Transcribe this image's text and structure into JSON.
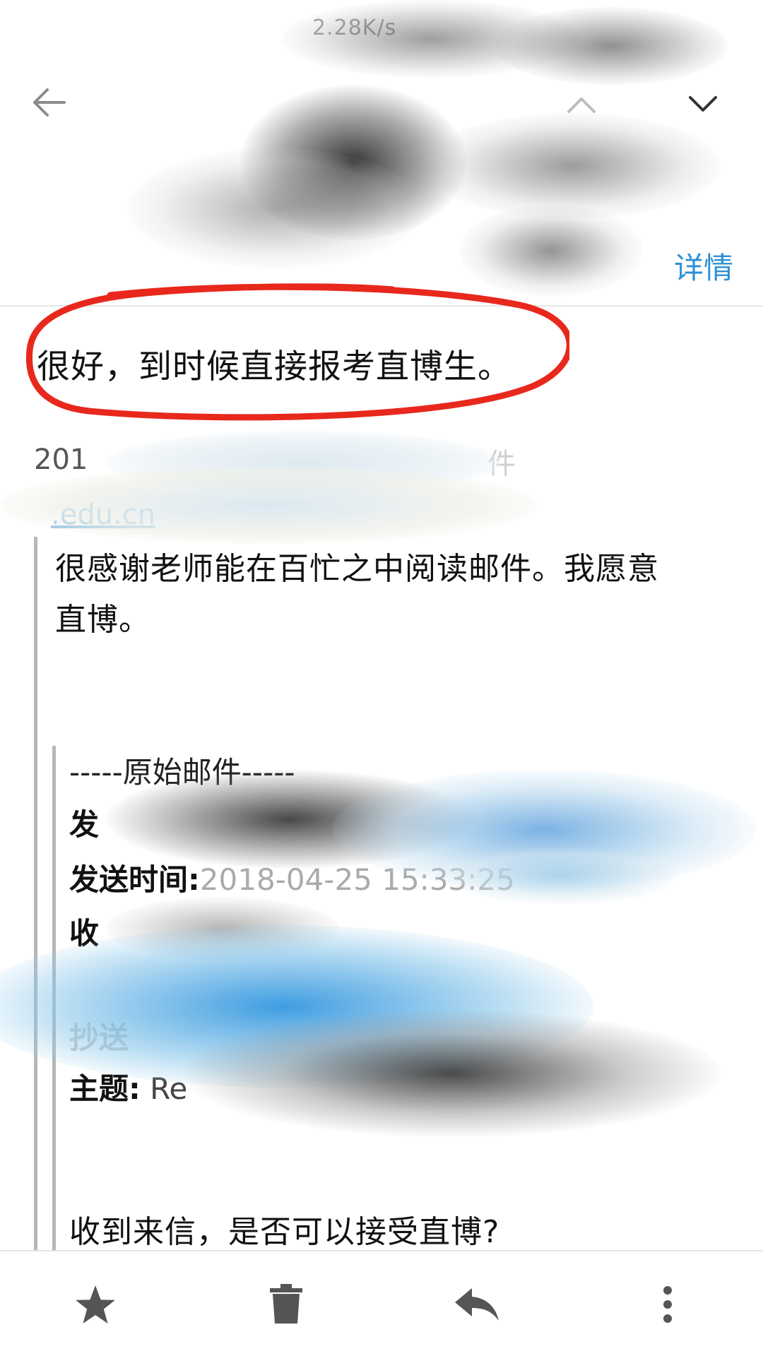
{
  "status": {
    "network_speed": "2.28K/s"
  },
  "toolbar": {
    "back_icon": "arrow-left-icon",
    "prev_icon": "chevron-up-icon",
    "next_icon": "chevron-down-icon"
  },
  "header": {
    "detail_label": "详情"
  },
  "message": {
    "reply_text": "很好，到时候直接报考直博生。",
    "quote_date": "201",
    "quote_tail": "件",
    "quote_email": ".edu.cn",
    "quote_line_1": "很感谢老师能在百忙之中阅读邮件。我愿意",
    "quote_line_2": "直博。"
  },
  "original_mail": {
    "separator": "-----原始邮件-----",
    "from_label": "发",
    "sent_label": "发送时间:",
    "sent_value": "2018-04-25 15:33:25",
    "to_label": "收",
    "cc_label": "抄送",
    "subject_label": "主题:",
    "subject_value": "Re",
    "question": "收到来信，是否可以接受直博?"
  },
  "bottom_bar": {
    "star_icon": "star-icon",
    "delete_icon": "trash-icon",
    "reply_icon": "reply-icon",
    "more_icon": "more-vert-icon"
  },
  "colors": {
    "link": "#2d8fd6",
    "annotation": "#e8281c"
  }
}
